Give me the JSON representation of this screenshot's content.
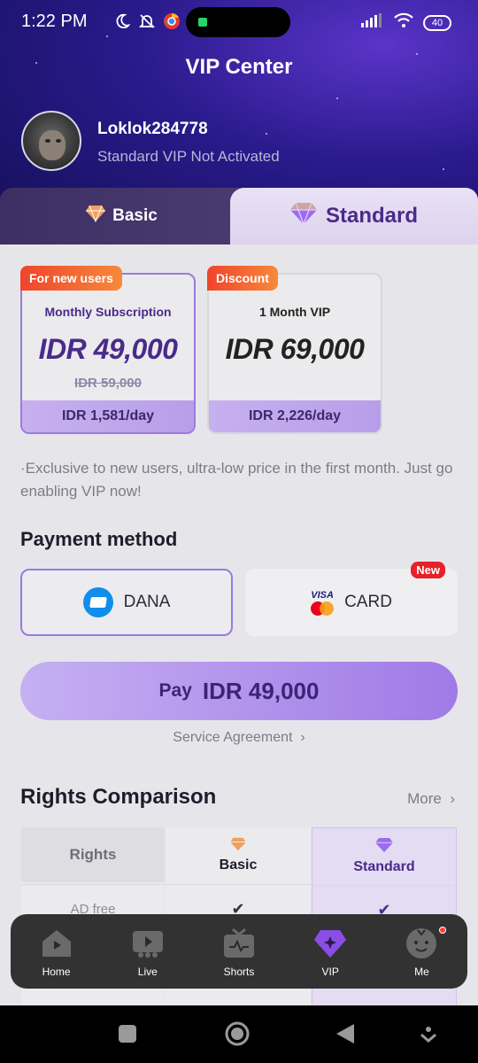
{
  "status": {
    "time": "1:22 PM",
    "battery": "40"
  },
  "header": {
    "title": "VIP Center",
    "username": "Loklok284778",
    "vip_status": "Standard VIP Not Activated"
  },
  "tabs": [
    {
      "label": "Basic",
      "icon": "diamond-orange-icon"
    },
    {
      "label": "Standard",
      "icon": "diamond-purple-icon"
    }
  ],
  "plans": [
    {
      "tag": "For new users",
      "name": "Monthly Subscription",
      "price": "IDR 49,000",
      "old_price": "IDR 59,000",
      "per_day": "IDR 1,581/day"
    },
    {
      "tag": "Discount",
      "name": "1 Month VIP",
      "price": "IDR 69,000",
      "per_day": "IDR 2,226/day"
    }
  ],
  "note": "·Exclusive to new users, ultra-low price in the first month. Just go enabling VIP now!",
  "payment": {
    "title": "Payment method",
    "methods": [
      {
        "label": "DANA"
      },
      {
        "label": "CARD",
        "badge": "New",
        "logo_text": "VISA"
      }
    ]
  },
  "pay_button": {
    "label": "Pay",
    "amount": "IDR 49,000"
  },
  "agreement": "Service Agreement",
  "rights": {
    "title": "Rights Comparison",
    "more": "More",
    "columns": [
      "Rights",
      "Basic",
      "Standard"
    ],
    "row1": "AD free"
  },
  "nav": [
    {
      "label": "Home",
      "icon": "home-icon"
    },
    {
      "label": "Live",
      "icon": "live-icon"
    },
    {
      "label": "Shorts",
      "icon": "shorts-icon"
    },
    {
      "label": "VIP",
      "icon": "vip-icon"
    },
    {
      "label": "Me",
      "icon": "me-icon"
    }
  ],
  "colors": {
    "accent": "#4a2a8a",
    "tag": "#f0442c",
    "pay": "#a07ae6",
    "new_badge": "#e8202a"
  }
}
